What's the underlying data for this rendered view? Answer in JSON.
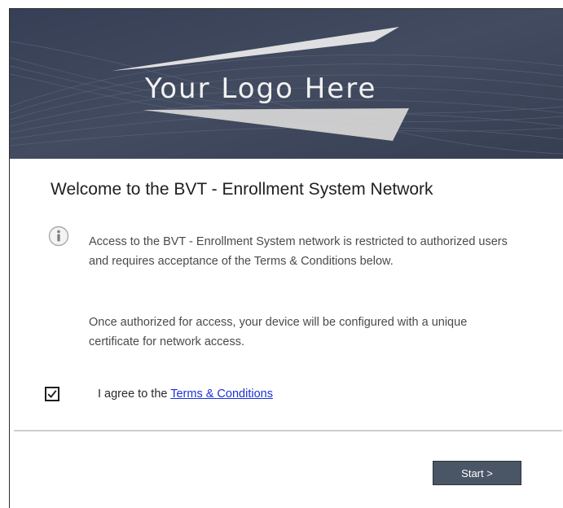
{
  "banner": {
    "logo_text": "Your Logo Here",
    "background_color": "#3b4459"
  },
  "welcome": {
    "title": "Welcome to the BVT - Enrollment System Network",
    "info_icon": "info-icon",
    "message_1": "Access to the BVT - Enrollment System network is restricted to authorized users and requires acceptance of the Terms & Conditions below.",
    "message_2": "Once authorized for access, your device will be configured with a unique certificate for network access."
  },
  "agreement": {
    "checked": true,
    "label": "I agree to the",
    "link_text": "Terms & Conditions",
    "link_color": "#1a31d6"
  },
  "actions": {
    "start_label": "Start >",
    "button_color": "#4a5565"
  }
}
